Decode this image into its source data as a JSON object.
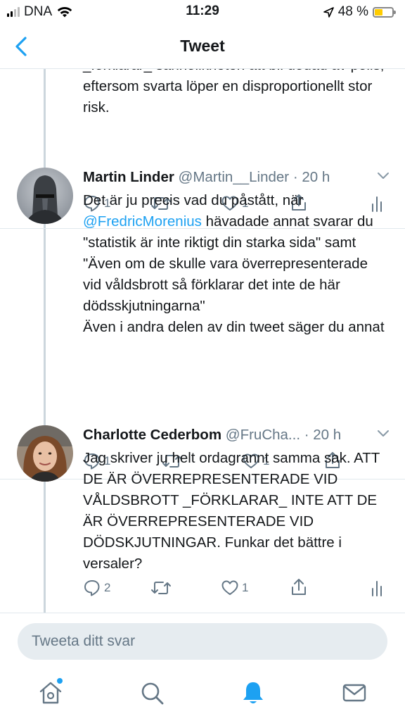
{
  "status": {
    "carrier": "DNA",
    "time": "11:29",
    "battery": "48 %",
    "battery_level": 0.48
  },
  "nav": {
    "title": "Tweet"
  },
  "thread": {
    "prev_tweet": {
      "text": "_förklarar_ sannolikheten att bli dödad av polis, eftersom svarta löper en disproportionellt stor risk.",
      "reply_count": "1",
      "like_count": "1"
    },
    "tweets": [
      {
        "name": "Martin Linder",
        "handle": "@Martin__Linder",
        "time": "· 20 h",
        "text_parts": [
          "Det är ju precis vad du påstått, när ",
          "@FredricMorenius",
          " hävadade annat svarar du \"statistik är inte riktigt din starka sida\" samt \"Även om de skulle vara överrepresenterade vid våldsbrott så förklarar det inte de här dödsskjutningarna\"",
          "Även i andra delen av din tweet säger du annat"
        ],
        "reply_count": "1",
        "like_count": "1"
      },
      {
        "name": "Charlotte Cederbom",
        "handle": "@FruCha...",
        "time": "· 20 h",
        "text": "Jag skriver ju helt ordagrannt samma sak. ATT DE ÄR ÖVERREPRESENTERADE VID VÅLDSBROTT _FÖRKLARAR_ INTE ATT DE ÄR ÖVERREPRESENTERADE VID DÖDSKJUTNINGAR. Funkar det bättre i versaler?",
        "reply_count": "2",
        "like_count": "1"
      }
    ]
  },
  "reply": {
    "placeholder": "Tweeta ditt svar"
  },
  "tabs": [
    {
      "icon": "home-icon"
    },
    {
      "icon": "search-icon"
    },
    {
      "icon": "notifications-icon"
    },
    {
      "icon": "messages-icon"
    }
  ],
  "colors": {
    "accent": "#1da1f2",
    "muted": "#657786",
    "text": "#14171a"
  }
}
